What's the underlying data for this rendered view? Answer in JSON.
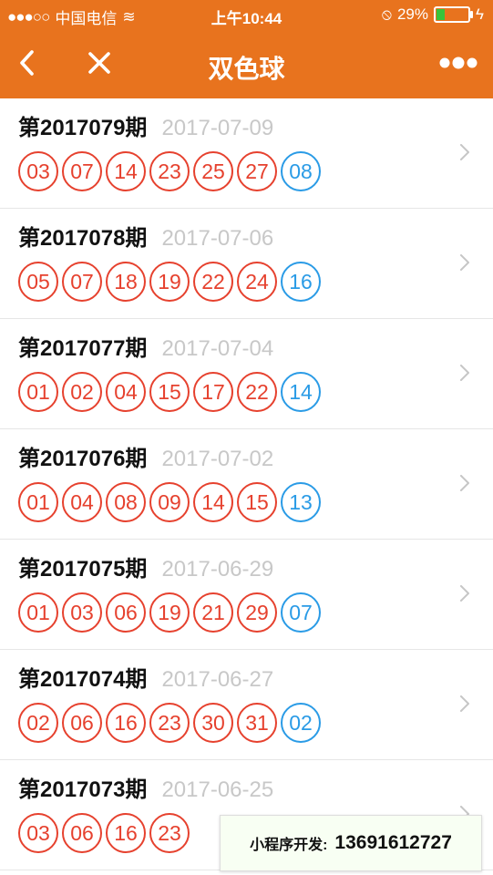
{
  "status": {
    "signal_dots": "●●●○○",
    "carrier": "中国电信",
    "wifi_symbol": "≋",
    "time": "上午10:44",
    "rotation_lock_symbol": "⦸",
    "battery_text": "29%",
    "battery_level": 0.29,
    "charging_symbol": "ϟ"
  },
  "nav": {
    "title": "双色球"
  },
  "draws": [
    {
      "issue": "第2017079期",
      "date": "2017-07-09",
      "reds": [
        "03",
        "07",
        "14",
        "23",
        "25",
        "27"
      ],
      "blue": "08"
    },
    {
      "issue": "第2017078期",
      "date": "2017-07-06",
      "reds": [
        "05",
        "07",
        "18",
        "19",
        "22",
        "24"
      ],
      "blue": "16"
    },
    {
      "issue": "第2017077期",
      "date": "2017-07-04",
      "reds": [
        "01",
        "02",
        "04",
        "15",
        "17",
        "22"
      ],
      "blue": "14"
    },
    {
      "issue": "第2017076期",
      "date": "2017-07-02",
      "reds": [
        "01",
        "04",
        "08",
        "09",
        "14",
        "15"
      ],
      "blue": "13"
    },
    {
      "issue": "第2017075期",
      "date": "2017-06-29",
      "reds": [
        "01",
        "03",
        "06",
        "19",
        "21",
        "29"
      ],
      "blue": "07"
    },
    {
      "issue": "第2017074期",
      "date": "2017-06-27",
      "reds": [
        "02",
        "06",
        "16",
        "23",
        "30",
        "31"
      ],
      "blue": "02"
    },
    {
      "issue": "第2017073期",
      "date": "2017-06-25",
      "reds": [
        "03",
        "06",
        "16",
        "23"
      ],
      "blue": ""
    }
  ],
  "footer": {
    "label": "小程序开发:",
    "phone": "13691612727"
  },
  "colors": {
    "brand": "#E8731E",
    "red_ball": "#E6412E",
    "blue_ball": "#2A9BE6"
  }
}
